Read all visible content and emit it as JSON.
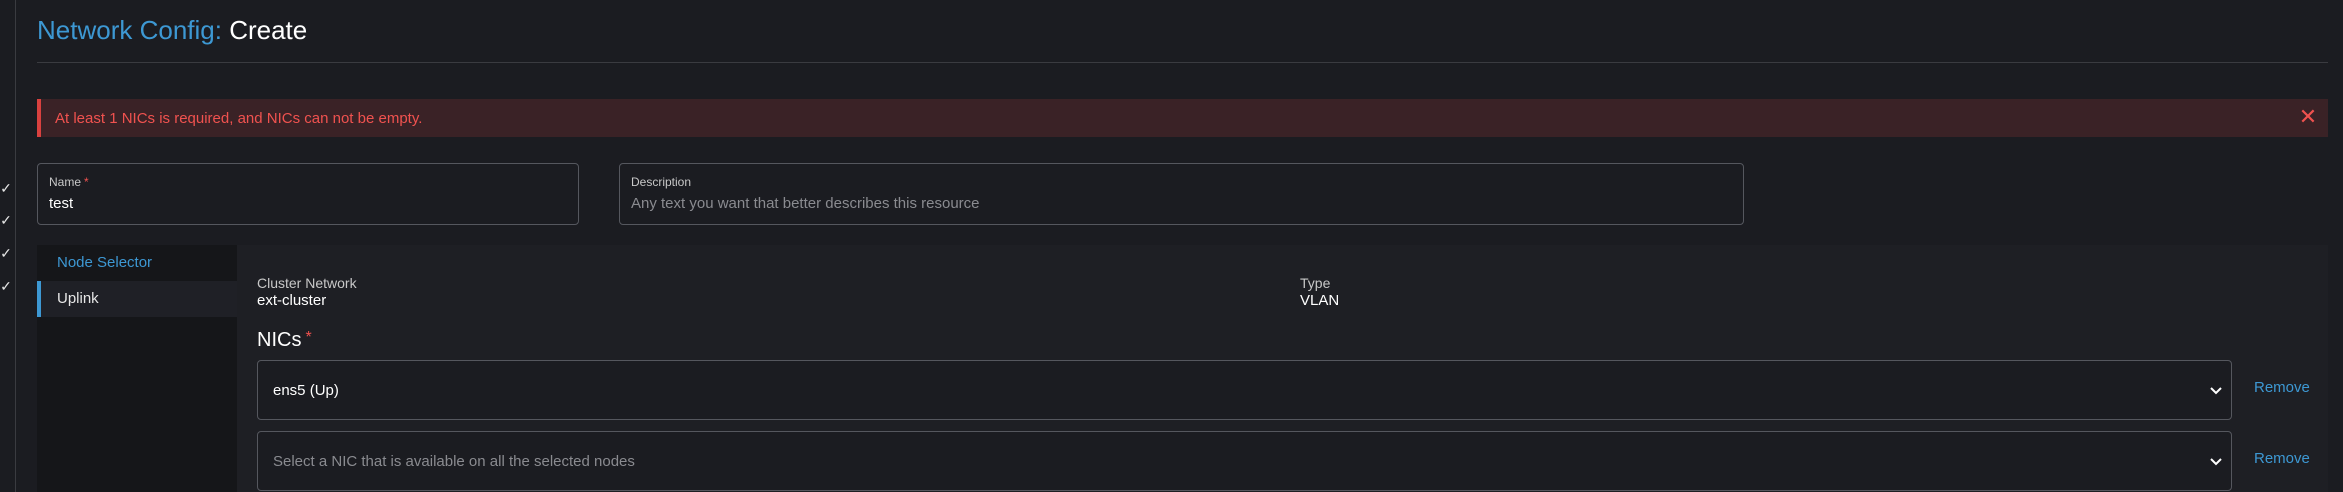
{
  "page": {
    "title_prefix": "Network Config:",
    "title_action": "Create"
  },
  "alert": {
    "message": "At least 1 NICs is required, and NICs can not be empty.",
    "close_glyph": "✕"
  },
  "form": {
    "name": {
      "label": "Name",
      "required_mark": "*",
      "value": "test"
    },
    "description": {
      "label": "Description",
      "placeholder": "Any text you want that better describes this resource"
    }
  },
  "tabs": [
    {
      "label": "Node Selector"
    },
    {
      "label": "Uplink"
    }
  ],
  "uplink": {
    "cluster_network_label": "Cluster Network",
    "cluster_network_value": "ext-cluster",
    "type_label": "Type",
    "type_value": "VLAN",
    "nics_title": "NICs",
    "nics_required_mark": "*",
    "nics": [
      {
        "value": "ens5 (Up)",
        "placeholder": "",
        "remove_label": "Remove"
      },
      {
        "value": "",
        "placeholder": "Select a NIC that is available on all the selected nodes",
        "remove_label": "Remove"
      }
    ]
  },
  "rail": {
    "check_glyph": "✓"
  },
  "colors": {
    "accent": "#3d98d3",
    "error": "#f0524f",
    "background": "#1b1c21"
  }
}
